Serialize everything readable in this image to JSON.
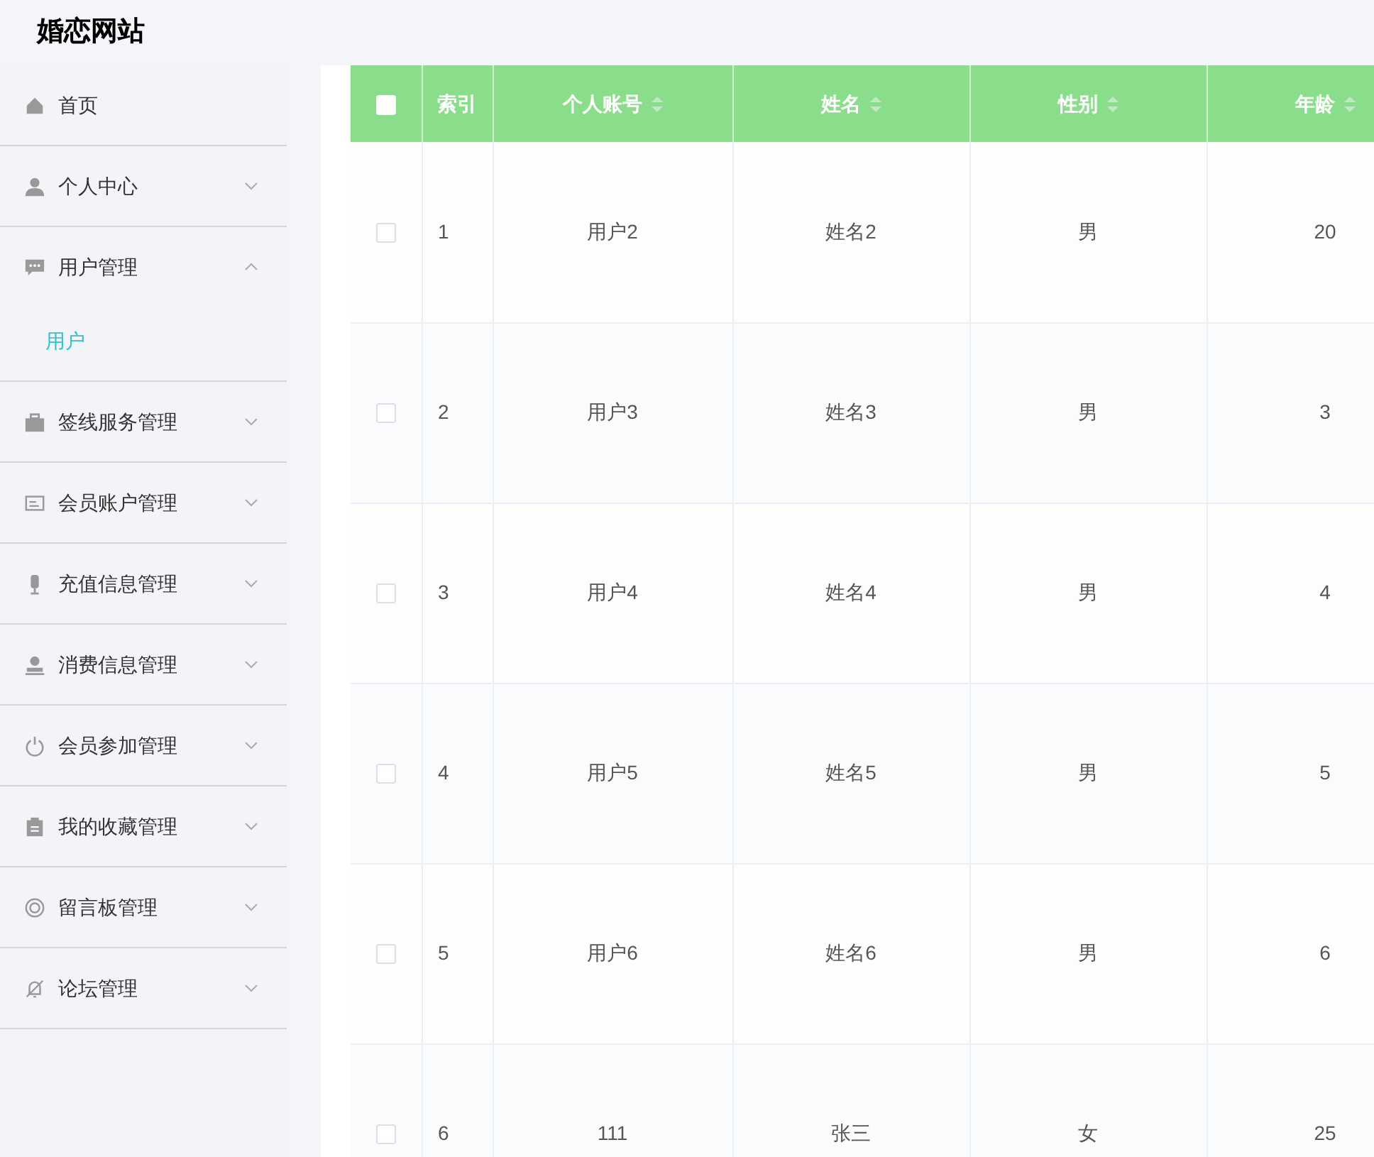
{
  "site_title": "婚恋网站",
  "sidebar": {
    "items": [
      {
        "label": "首页",
        "expandable": false
      },
      {
        "label": "个人中心",
        "expandable": true,
        "expanded": false
      },
      {
        "label": "用户管理",
        "expandable": true,
        "expanded": true,
        "children": [
          {
            "label": "用户",
            "selected": true
          }
        ]
      },
      {
        "label": "签线服务管理",
        "expandable": true,
        "expanded": false
      },
      {
        "label": "会员账户管理",
        "expandable": true,
        "expanded": false
      },
      {
        "label": "充值信息管理",
        "expandable": true,
        "expanded": false
      },
      {
        "label": "消费信息管理",
        "expandable": true,
        "expanded": false
      },
      {
        "label": "会员参加管理",
        "expandable": true,
        "expanded": false
      },
      {
        "label": "我的收藏管理",
        "expandable": true,
        "expanded": false
      },
      {
        "label": "留言板管理",
        "expandable": true,
        "expanded": false
      },
      {
        "label": "论坛管理",
        "expandable": true,
        "expanded": false
      }
    ]
  },
  "table": {
    "all_checked": false,
    "columns": [
      {
        "label": "索引",
        "sortable": false
      },
      {
        "label": "个人账号",
        "sortable": true
      },
      {
        "label": "姓名",
        "sortable": true
      },
      {
        "label": "性别",
        "sortable": true
      },
      {
        "label": "年龄",
        "sortable": true
      }
    ],
    "rows": [
      {
        "checked": false,
        "cells": [
          "1",
          "用户2",
          "姓名2",
          "男",
          "20"
        ]
      },
      {
        "checked": false,
        "cells": [
          "2",
          "用户3",
          "姓名3",
          "男",
          "3"
        ]
      },
      {
        "checked": false,
        "cells": [
          "3",
          "用户4",
          "姓名4",
          "男",
          "4"
        ]
      },
      {
        "checked": false,
        "cells": [
          "4",
          "用户5",
          "姓名5",
          "男",
          "5"
        ]
      },
      {
        "checked": false,
        "cells": [
          "5",
          "用户6",
          "姓名6",
          "男",
          "6"
        ]
      },
      {
        "checked": false,
        "cells": [
          "6",
          "111",
          "张三",
          "女",
          "25"
        ]
      }
    ]
  }
}
